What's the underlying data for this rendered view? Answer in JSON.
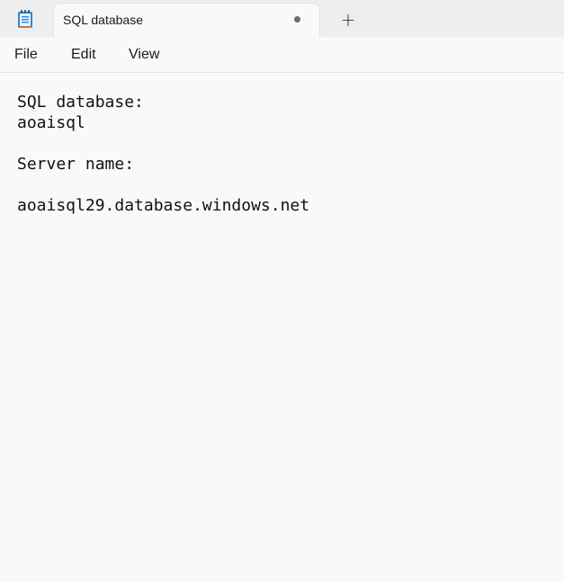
{
  "app": {
    "icon": "notepad-icon"
  },
  "tabs": [
    {
      "title": "SQL database",
      "modified": true
    }
  ],
  "new_tab_glyph": "+",
  "menu": {
    "items": [
      "File",
      "Edit",
      "View"
    ]
  },
  "document": {
    "lines": [
      "SQL database:",
      "aoaisql",
      "",
      "Server name:",
      "",
      "aoaisql29.database.windows.net"
    ]
  }
}
